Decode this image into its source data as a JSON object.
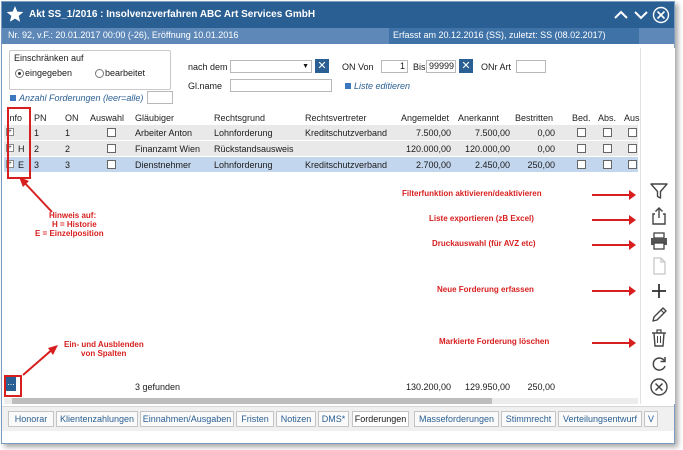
{
  "window": {
    "title": "Akt SS_1/2016 : Insolvenzverfahren ABC Art Services GmbH",
    "case_info": "Nr. 92, v.F.: 20.01.2017 00:00 (-26), Eröffnung 10.01.2016",
    "record_info": "Erfasst am 20.12.2016 (SS), zuletzt: SS (08.02.2017)"
  },
  "filter": {
    "group_label": "Einschränken auf",
    "radio_eingegeben": "eingegeben",
    "radio_bearbeitet": "bearbeitet",
    "anzahl_label": "Anzahl Forderungen (leer=alle)",
    "nach_dem_label": "nach dem",
    "glname_label": "Gl.name",
    "on_von_label": "ON  Von",
    "von_value": "1",
    "bis_label": "Bis",
    "bis_value": "99999",
    "onr_art_label": "ONr Art",
    "liste_editieren": "Liste editieren"
  },
  "grid": {
    "columns": [
      "Info",
      "PN",
      "ON",
      "Auswahl",
      "Gläubiger",
      "Rechtsgrund",
      "Rechtsvertreter",
      "Angemeldet",
      "Anerkannt",
      "Bestritten",
      "Bed.",
      "Abs.",
      "Aus."
    ],
    "rows": [
      {
        "info": "",
        "pn": "1",
        "on": "1",
        "glaeubiger": "Arbeiter Anton",
        "rechtsgrund": "Lohnforderung",
        "rechtsvertreter": "Kreditschutzverband",
        "angemeldet": "7.500,00",
        "anerkannt": "7.500,00",
        "bestritten": "0,00"
      },
      {
        "info": "H",
        "pn": "2",
        "on": "2",
        "glaeubiger": "Finanzamt Wien",
        "rechtsgrund": "Rückstandsausweis",
        "rechtsvertreter": "",
        "angemeldet": "120.000,00",
        "anerkannt": "120.000,00",
        "bestritten": "0,00"
      },
      {
        "info": "E",
        "pn": "3",
        "on": "3",
        "glaeubiger": "Dienstnehmer",
        "rechtsgrund": "Lohnforderung",
        "rechtsvertreter": "Kreditschutzverband",
        "angemeldet": "2.700,00",
        "anerkannt": "2.450,00",
        "bestritten": "250,00"
      }
    ],
    "found_text": "3 gefunden",
    "sum_angemeldet": "130.200,00",
    "sum_anerkannt": "129.950,00",
    "sum_bestritten": "250,00",
    "columns_button": "..."
  },
  "annotations": {
    "hinweis_line1": "Hinweis auf:",
    "hinweis_line2": "H = Historie",
    "hinweis_line3": "E = Einzelposition",
    "spalten_line1": "Ein- und Ausblenden",
    "spalten_line2": "von Spalten",
    "filter": "Filterfunktion aktivieren/deaktivieren",
    "export": "Liste exportieren (zB Excel)",
    "druck": "Druckauswahl (für AVZ etc)",
    "neu": "Neue Forderung erfassen",
    "loeschen": "Markierte Forderung löschen"
  },
  "toolbar_icons": [
    "filter-icon",
    "export-icon",
    "print-icon",
    "document-icon",
    "plus-icon",
    "pencil-icon",
    "trash-icon",
    "refresh-icon",
    "close-circle-icon"
  ],
  "tabs": [
    "Honorar",
    "Klientenzahlungen",
    "Einnahmen/Ausgaben",
    "Fristen",
    "Notizen",
    "DMS*",
    "Forderungen",
    "Masseforderungen",
    "Stimmrecht",
    "Verteilungsentwurf",
    "V"
  ],
  "active_tab": "Forderungen",
  "colors": {
    "titlebar": "#2a5f93",
    "infobar": "#5d88b8",
    "accent_red": "#d81f1f",
    "selected_row": "#c2d6ee"
  }
}
